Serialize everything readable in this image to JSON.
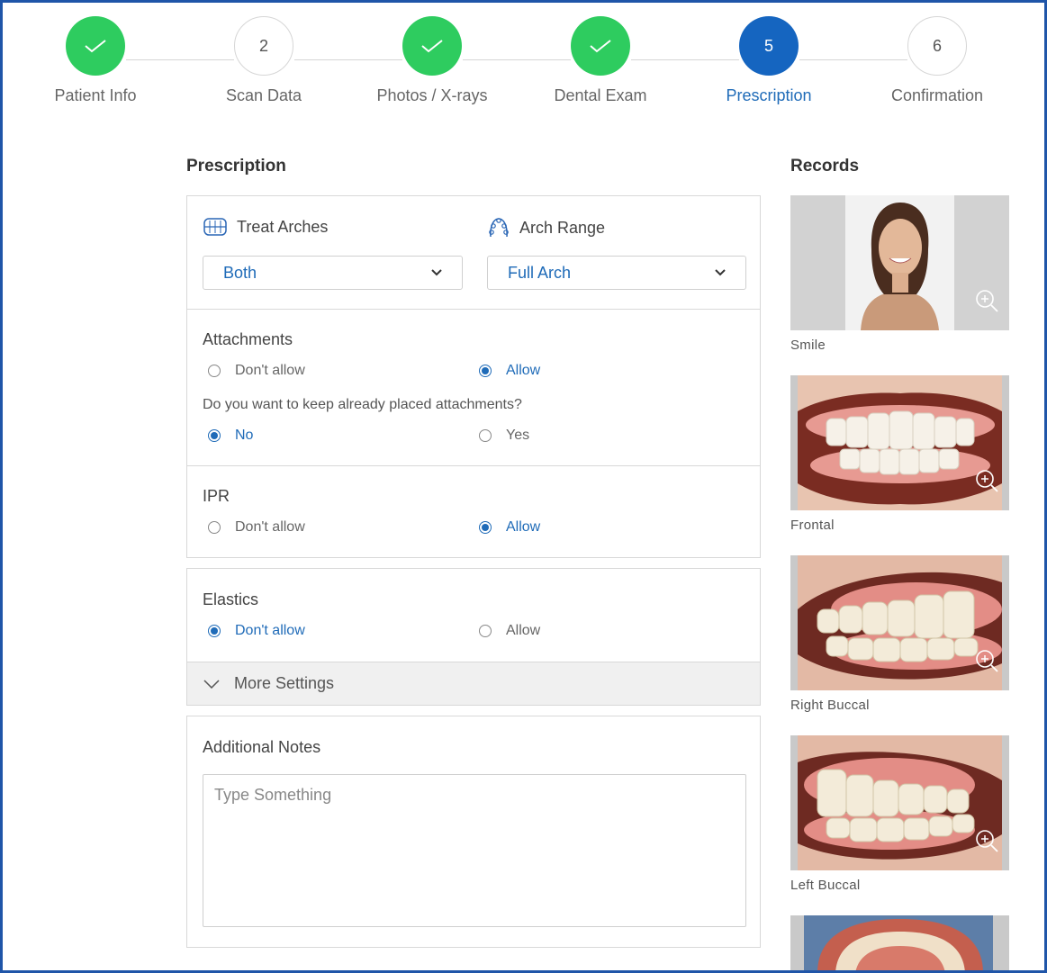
{
  "stepper": {
    "steps": [
      {
        "label": "Patient Info",
        "state": "done",
        "number": ""
      },
      {
        "label": "Scan Data",
        "state": "todo",
        "number": "2"
      },
      {
        "label": "Photos / X-rays",
        "state": "done",
        "number": ""
      },
      {
        "label": "Dental Exam",
        "state": "done",
        "number": ""
      },
      {
        "label": "Prescription",
        "state": "active",
        "number": "5"
      },
      {
        "label": "Confirmation",
        "state": "todo",
        "number": "6"
      }
    ]
  },
  "prescription": {
    "title": "Prescription",
    "treat_arches": {
      "label": "Treat Arches",
      "value": "Both",
      "icon": "teeth-icon"
    },
    "arch_range": {
      "label": "Arch Range",
      "value": "Full Arch",
      "icon": "arch-icon"
    },
    "attachments": {
      "title": "Attachments",
      "options": [
        "Don't allow",
        "Allow"
      ],
      "selected": "Allow",
      "keep_question": "Do you want to keep already placed attachments?",
      "keep_options": [
        "No",
        "Yes"
      ],
      "keep_selected": "No"
    },
    "ipr": {
      "title": "IPR",
      "options": [
        "Don't allow",
        "Allow"
      ],
      "selected": "Allow"
    },
    "elastics": {
      "title": "Elastics",
      "options": [
        "Don't allow",
        "Allow"
      ],
      "selected": "Don't allow"
    },
    "more_settings": "More Settings",
    "notes": {
      "title": "Additional Notes",
      "placeholder": "Type Something"
    }
  },
  "records": {
    "title": "Records",
    "items": [
      {
        "caption": "Smile"
      },
      {
        "caption": "Frontal"
      },
      {
        "caption": "Right Buccal"
      },
      {
        "caption": "Left Buccal"
      }
    ]
  },
  "colors": {
    "accent": "#1565c0",
    "done": "#2ecc5f",
    "link": "#1f6bb8"
  }
}
